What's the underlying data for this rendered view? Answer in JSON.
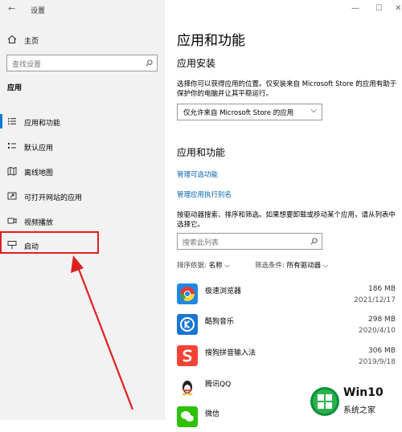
{
  "window": {
    "title": "设置",
    "back": "←"
  },
  "sidebar": {
    "home_label": "主页",
    "search_placeholder": "查找设置",
    "section_title": "应用",
    "items": [
      {
        "label": "应用和功能"
      },
      {
        "label": "默认应用"
      },
      {
        "label": "离线地图"
      },
      {
        "label": "可打开网站的应用"
      },
      {
        "label": "视频播放"
      },
      {
        "label": "启动"
      }
    ]
  },
  "main": {
    "page_title": "应用和功能",
    "install_section_title": "应用安装",
    "install_desc": "选择你可以获得应用的位置。仅安装来自 Microsoft Store 的应用有助于保护你的电脑并让其平稳运行。",
    "install_dropdown_value": "仅允许来自 Microsoft Store 的应用",
    "apps_section_title": "应用和功能",
    "link_optional_features": "管理可选功能",
    "link_execution_aliases": "管理应用执行别名",
    "apps_desc": "按驱动器搜索、排序和筛选。如果想要卸载或移动某个应用，请从列表中选择它。",
    "search_placeholder": "搜索此列表",
    "sort_label": "排序依据:",
    "sort_value": "名称",
    "filter_label": "筛选条件:",
    "filter_value": "所有驱动器",
    "apps": [
      {
        "name": "极速浏览器",
        "size": "186 MB",
        "date": "2021/12/17"
      },
      {
        "name": "酷狗音乐",
        "size": "298 MB",
        "date": "2020/4/10"
      },
      {
        "name": "搜狗拼音输入法",
        "size": "306 MB",
        "date": "2019/9/18"
      },
      {
        "name": "腾讯QQ",
        "size": "",
        "date": ""
      },
      {
        "name": "微信",
        "size": "",
        "date": ""
      }
    ]
  },
  "watermark": {
    "brand": "Win10",
    "site": "系统之家"
  },
  "colors": {
    "link": "#0063b1",
    "annotation": "#e02020",
    "accent": "#0078d7"
  }
}
